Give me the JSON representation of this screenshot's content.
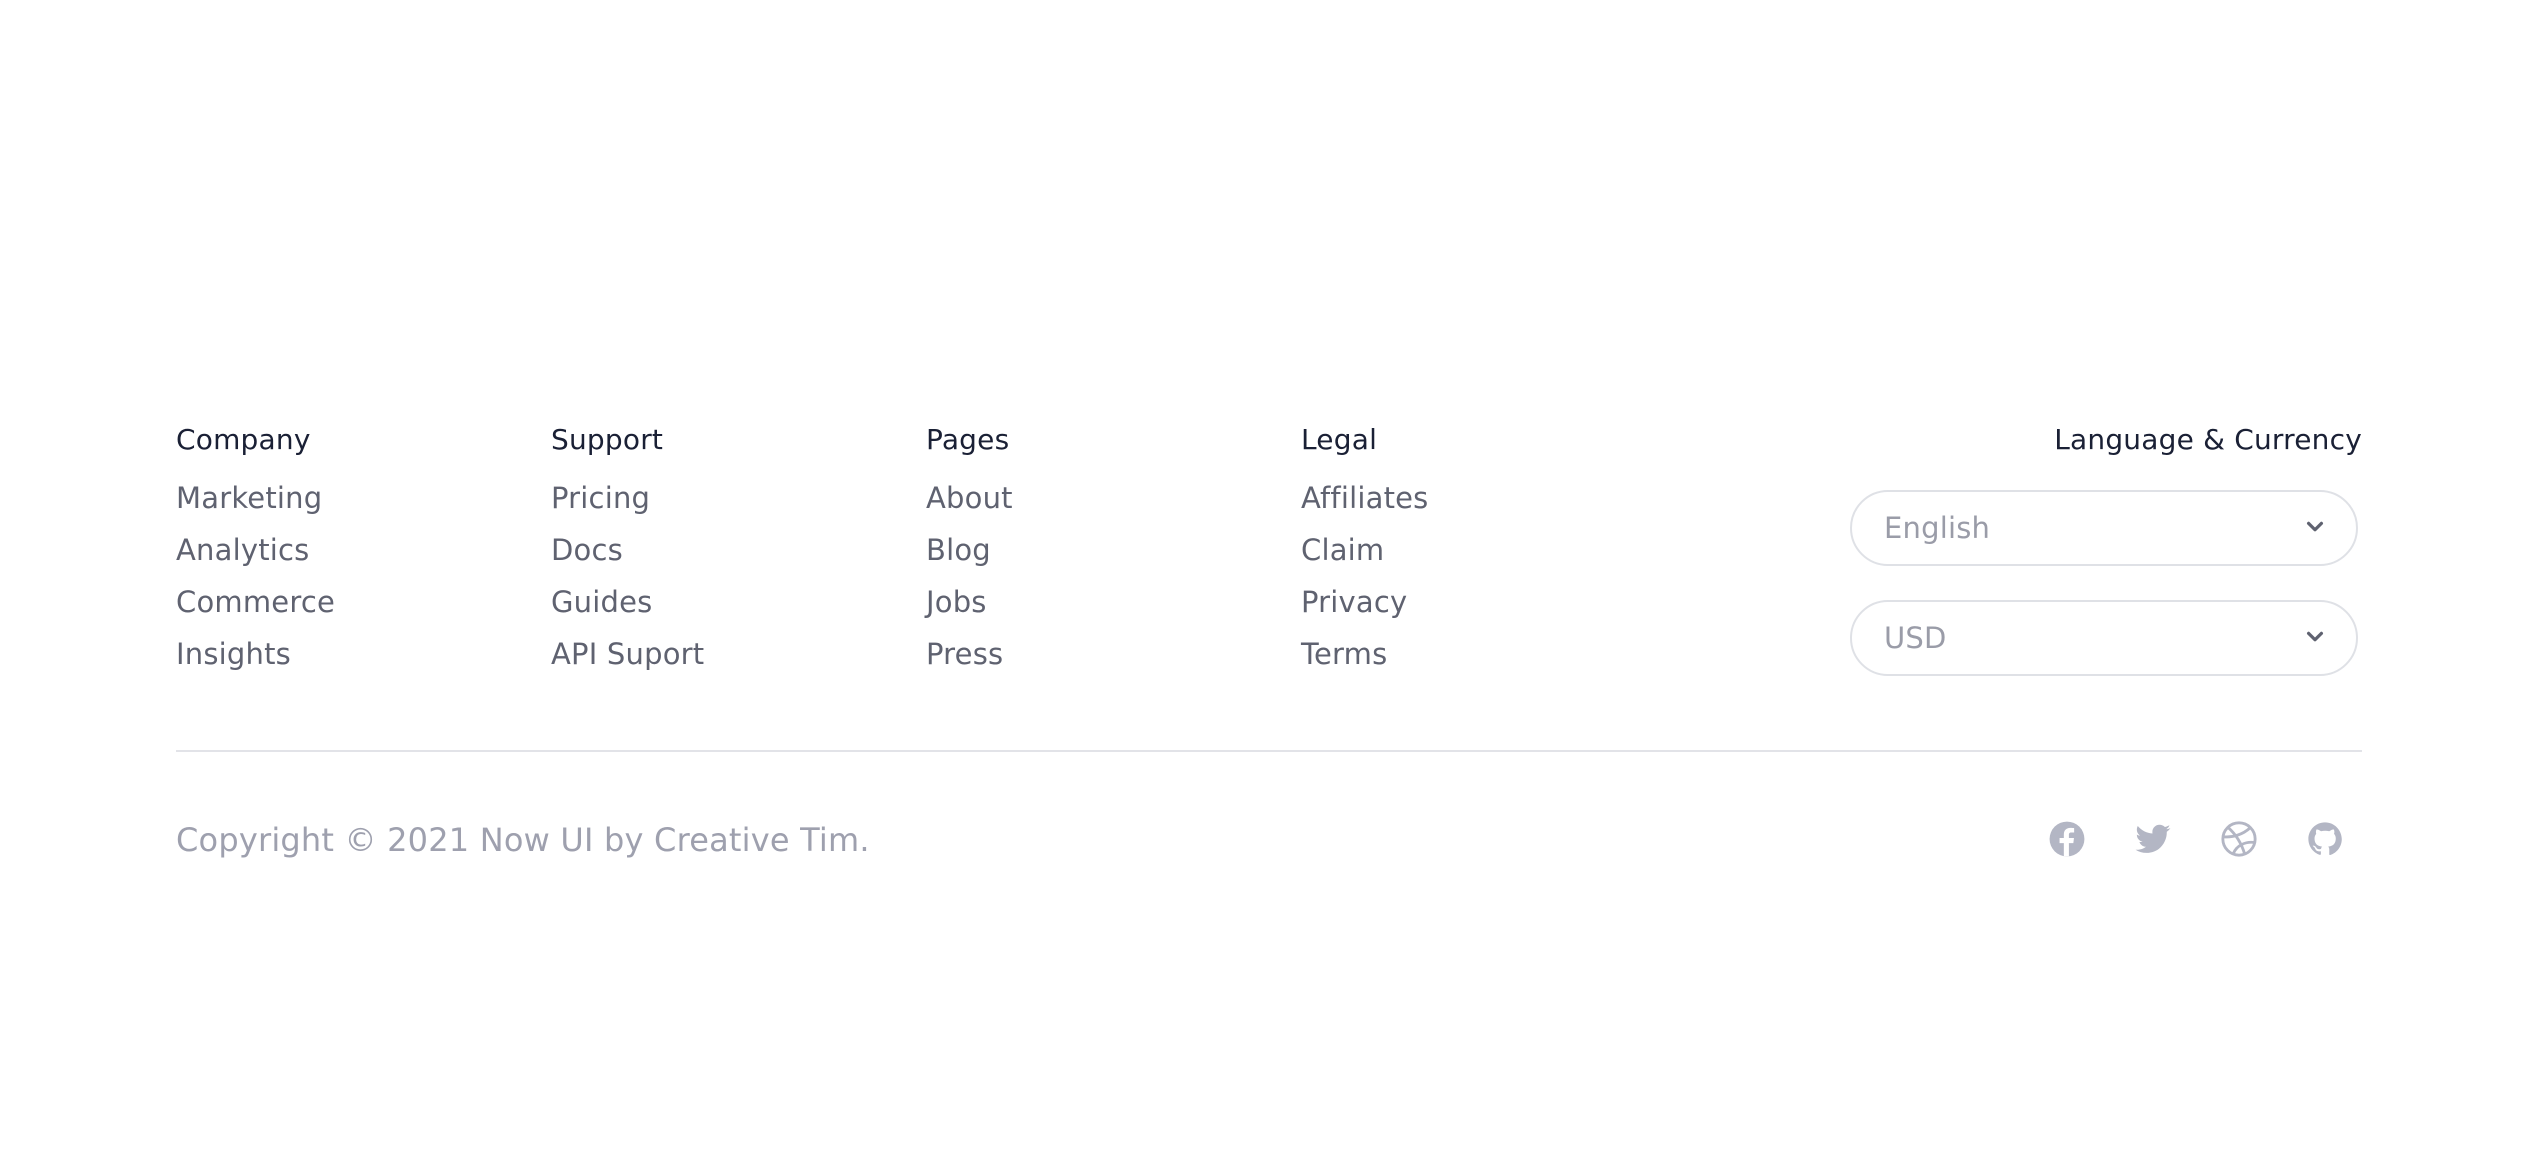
{
  "footer": {
    "columns": [
      {
        "title": "Company",
        "links": [
          "Marketing",
          "Analytics",
          "Commerce",
          "Insights"
        ]
      },
      {
        "title": "Support",
        "links": [
          "Pricing",
          "Docs",
          "Guides",
          "API Suport"
        ]
      },
      {
        "title": "Pages",
        "links": [
          "About",
          "Blog",
          "Jobs",
          "Press"
        ]
      },
      {
        "title": "Legal",
        "links": [
          "Affiliates",
          "Claim",
          "Privacy",
          "Terms"
        ]
      }
    ],
    "language_currency": {
      "title": "Language & Currency",
      "language_value": "English",
      "currency_value": "USD"
    },
    "copyright": "Copyright © 2021 Now UI by Creative Tim.",
    "socials": [
      "facebook-icon",
      "twitter-icon",
      "dribbble-icon",
      "github-icon"
    ],
    "colors": {
      "heading": "#1a2035",
      "link": "#5f6270",
      "muted": "#9ea0ae",
      "icon": "#b3b6c4",
      "border": "#dfe1e6"
    }
  }
}
